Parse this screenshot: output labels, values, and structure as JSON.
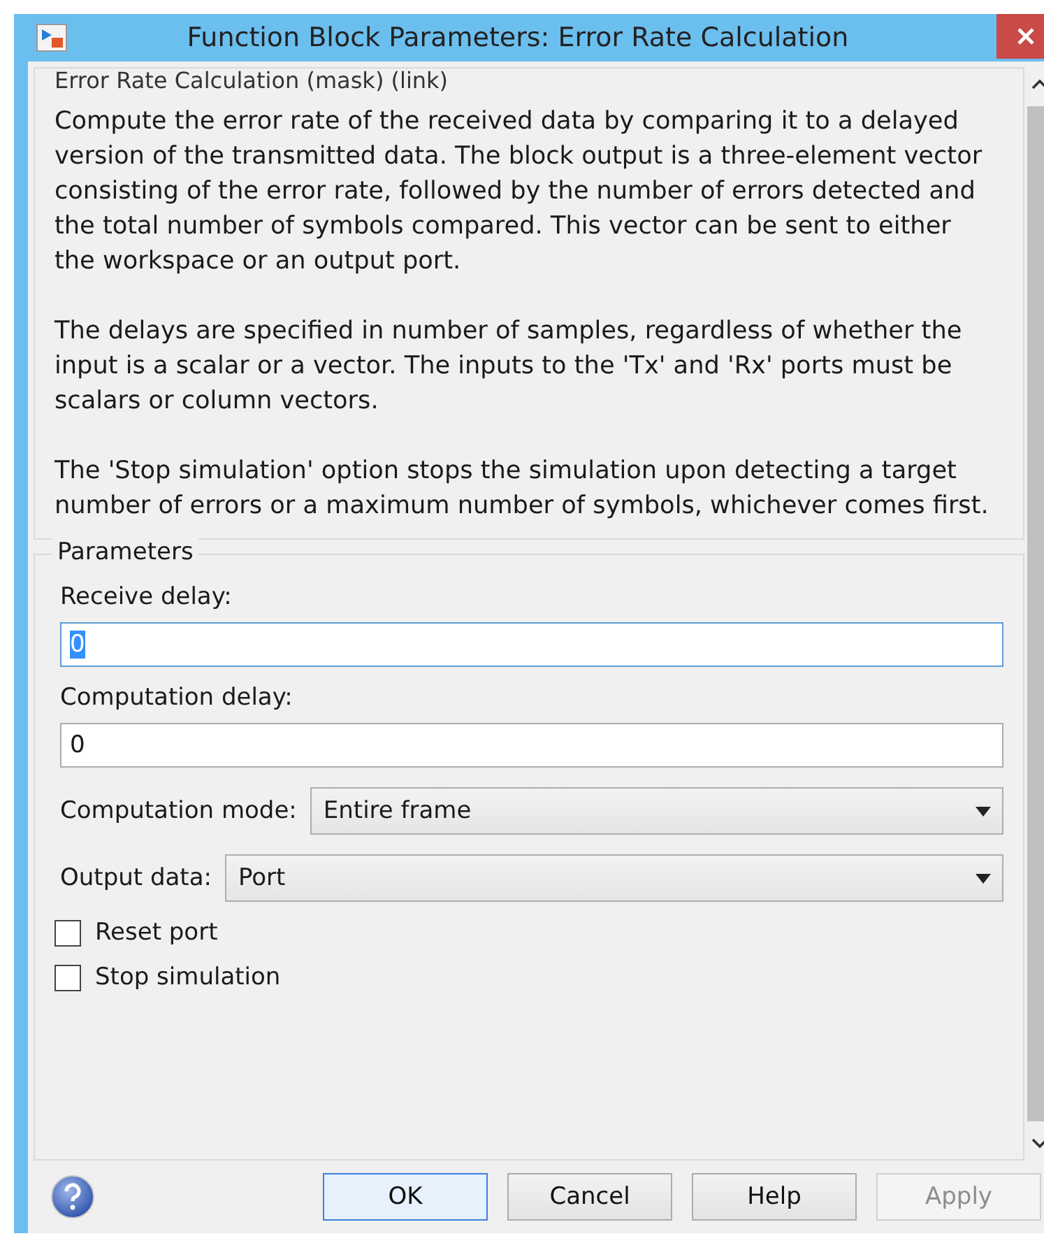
{
  "window": {
    "title": "Function Block Parameters: Error Rate Calculation"
  },
  "description": {
    "heading": "Error Rate Calculation (mask) (link)",
    "paragraphs": [
      "Compute the error rate of the received data by comparing it to a delayed version of the transmitted data. The block output is a three-element vector consisting of the error rate, followed by the number of errors detected and the total number of symbols compared. This vector can be sent to either the workspace or an output port.",
      "The delays are specified in number of samples, regardless of whether the input is a scalar or a vector. The inputs to the 'Tx' and 'Rx' ports must be scalars or column vectors.",
      "The 'Stop simulation' option stops the simulation upon detecting a target number of errors or a maximum number of symbols, whichever comes first."
    ]
  },
  "parameters": {
    "legend": "Parameters",
    "fields": [
      {
        "kind": "text",
        "label": "Receive delay:",
        "value": "0",
        "focused": true
      },
      {
        "kind": "text",
        "label": "Computation delay:",
        "value": "0",
        "focused": false
      },
      {
        "kind": "dropdown",
        "label": "Computation mode:",
        "value": "Entire frame"
      },
      {
        "kind": "dropdown",
        "label": "Output data:",
        "value": "Port"
      },
      {
        "kind": "checkbox",
        "label": "Reset port",
        "checked": false
      },
      {
        "kind": "checkbox",
        "label": "Stop simulation",
        "checked": false
      }
    ]
  },
  "buttons": [
    {
      "label": "OK",
      "default": true,
      "disabled": false
    },
    {
      "label": "Cancel",
      "default": false,
      "disabled": false
    },
    {
      "label": "Help",
      "default": false,
      "disabled": false
    },
    {
      "label": "Apply",
      "default": false,
      "disabled": true
    }
  ]
}
